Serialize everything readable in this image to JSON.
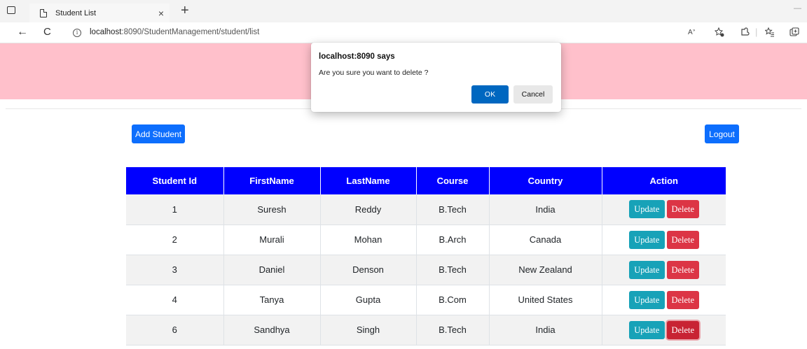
{
  "browser": {
    "tab_title": "Student List",
    "tab_close": "×",
    "new_tab": "+",
    "url_host": "localhost",
    "url_path": ":8090/StudentManagement/student/list",
    "back_icon": "←",
    "refresh_icon": "C",
    "info_icon": "i",
    "minimize": "—"
  },
  "page": {
    "header_color": "#ffc0cb",
    "add_button": "Add Student",
    "logout_button": "Logout"
  },
  "table": {
    "columns": [
      "Student Id",
      "FirstName",
      "LastName",
      "Course",
      "Country",
      "Action"
    ],
    "rows": [
      {
        "id": "1",
        "first": "Suresh",
        "last": "Reddy",
        "course": "B.Tech",
        "country": "India"
      },
      {
        "id": "2",
        "first": "Murali",
        "last": "Mohan",
        "course": "B.Arch",
        "country": "Canada"
      },
      {
        "id": "3",
        "first": "Daniel",
        "last": "Denson",
        "course": "B.Tech",
        "country": "New Zealand"
      },
      {
        "id": "4",
        "first": "Tanya",
        "last": "Gupta",
        "course": "B.Com",
        "country": "United States"
      },
      {
        "id": "6",
        "first": "Sandhya",
        "last": "Singh",
        "course": "B.Tech",
        "country": "India"
      }
    ],
    "update_label": "Update",
    "delete_label": "Delete"
  },
  "dialog": {
    "title": "localhost:8090 says",
    "message": "Are you sure you want to delete ?",
    "ok": "OK",
    "cancel": "Cancel"
  },
  "colors": {
    "table_header": "#0000ff",
    "primary": "#0d6efd",
    "update": "#17a2b8",
    "delete": "#dc3545",
    "dialog_ok": "#0067c0"
  }
}
